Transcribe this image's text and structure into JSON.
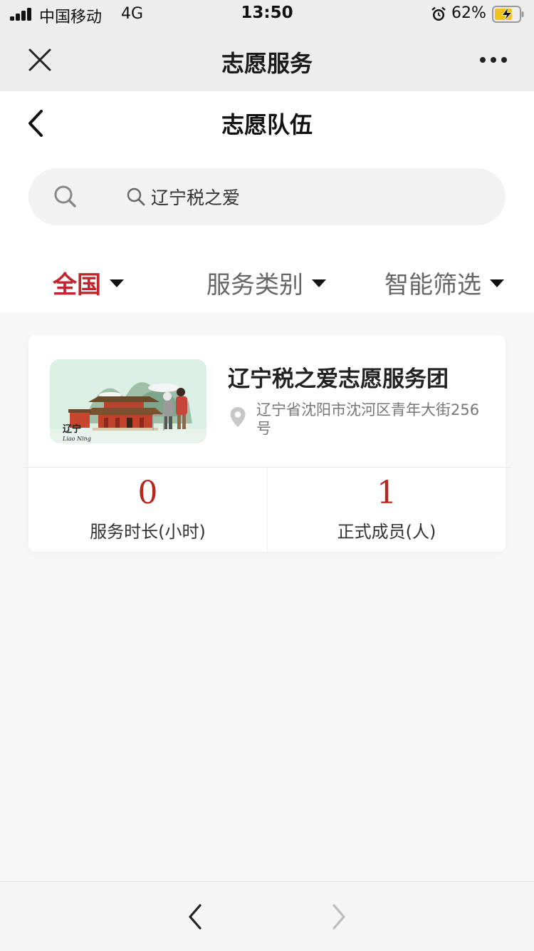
{
  "status_bar": {
    "carrier": "中国移动",
    "network": "4G",
    "time": "13:50",
    "battery_percent": "62%",
    "icons": [
      "signal-icon",
      "alarm-icon",
      "battery-charging-icon"
    ]
  },
  "wechat_header": {
    "title": "志愿服务",
    "close_icon": "close-icon",
    "more_icon": "more-icon"
  },
  "page": {
    "title": "志愿队伍",
    "back_icon": "chevron-left-icon"
  },
  "search": {
    "query": "辽宁税之爱",
    "icon": "search-icon"
  },
  "filters": [
    {
      "label": "全国",
      "active": true
    },
    {
      "label": "服务类别",
      "active": false
    },
    {
      "label": "智能筛选",
      "active": false
    }
  ],
  "results": [
    {
      "name": "辽宁税之爱志愿服务团",
      "address": "辽宁省沈阳市沈河区青年大街256号",
      "image_text": "辽宁",
      "image_subtext": "Liao Ning",
      "stats": [
        {
          "value": "0",
          "label": "服务时长(小时)"
        },
        {
          "value": "1",
          "label": "正式成员(人)"
        }
      ]
    }
  ],
  "colors": {
    "accent_red": "#c0272d",
    "stat_red": "#b5281e",
    "header_gray": "#ededed",
    "page_bg": "#f7f7f7"
  },
  "toolbar": {
    "back_icon": "chevron-left-icon",
    "forward_icon": "chevron-right-icon"
  }
}
